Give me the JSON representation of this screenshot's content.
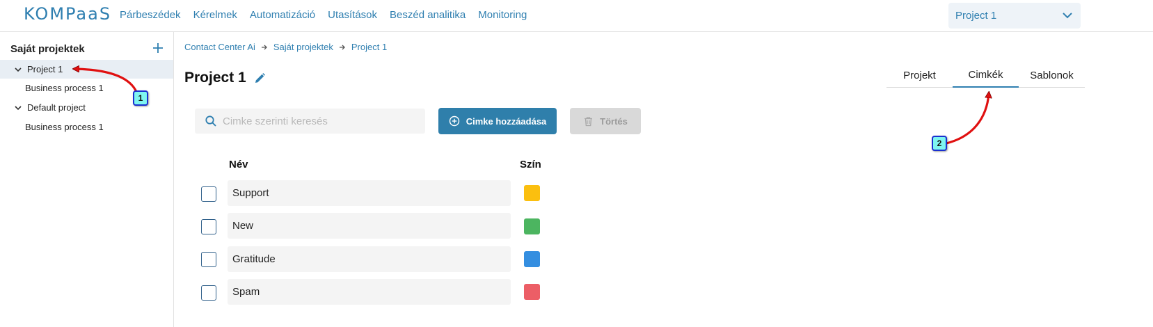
{
  "header": {
    "logo": "KOMPaaS",
    "nav": [
      "Párbeszédek",
      "Kérelmek",
      "Automatizáció",
      "Utasítások",
      "Beszéd analitika",
      "Monitoring"
    ],
    "project_select": "Project 1"
  },
  "sidebar": {
    "title": "Saját projektek",
    "items": [
      {
        "label": "Project 1"
      },
      {
        "label": "Business process 1"
      },
      {
        "label": "Default project"
      },
      {
        "label": "Business process 1"
      }
    ]
  },
  "breadcrumb": [
    "Contact Center Ai",
    "Saját projektek",
    "Project 1"
  ],
  "page": {
    "title": "Project 1"
  },
  "tabs": [
    "Projekt",
    "Cimkék",
    "Sablonok"
  ],
  "search": {
    "placeholder": "Cimke szerinti keresés",
    "value": ""
  },
  "buttons": {
    "add": "Cimke hozzáadása",
    "delete": "Törtés"
  },
  "table": {
    "headers": [
      "Név",
      "Szín"
    ],
    "rows": [
      {
        "name": "Support",
        "color": "#fbbf0f"
      },
      {
        "name": "New",
        "color": "#4cb560"
      },
      {
        "name": "Gratitude",
        "color": "#348ee0"
      },
      {
        "name": "Spam",
        "color": "#ec5e66"
      }
    ]
  },
  "annotations": [
    "1",
    "2"
  ],
  "colors": {
    "accent": "#2f7fb0",
    "arrow": "#e01010"
  }
}
